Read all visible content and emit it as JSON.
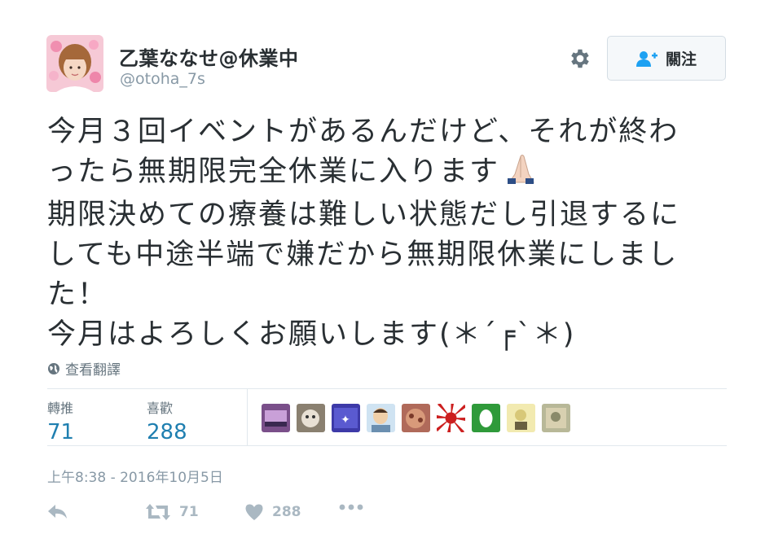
{
  "user": {
    "display_name": "乙葉ななせ@休業中",
    "handle": "@otoha_7s",
    "avatar_icon": "user-avatar-photo"
  },
  "header": {
    "settings_icon": "gear-icon",
    "follow_label": "關注",
    "follow_icon": "add-user-icon"
  },
  "tweet": {
    "lines": [
      "今月３回イベントがあるんだけど、それが終わ",
      "ったら無期限完全休業に入ります",
      "期限決めての療養は難しい状態だし引退するに",
      "しても中途半端で嫌だから無期限休業にしまし",
      "た！",
      "今月はよろしくお願いします(＊´╒`＊)"
    ],
    "emoji_icon": "folded-hands-icon"
  },
  "translate": {
    "label": "查看翻譯",
    "icon": "globe-icon"
  },
  "stats": {
    "retweets_label": "轉推",
    "retweets_count": "71",
    "likes_label": "喜歡",
    "likes_count": "288"
  },
  "likers": [
    {
      "icon": "liker-avatar-1",
      "color": "#7a4f8a"
    },
    {
      "icon": "liker-avatar-2",
      "color": "#8a8070"
    },
    {
      "icon": "liker-avatar-3",
      "color": "#3d3aa8"
    },
    {
      "icon": "liker-avatar-4",
      "color": "#6b8fb0"
    },
    {
      "icon": "liker-avatar-5",
      "color": "#b06a5a"
    },
    {
      "icon": "liker-avatar-6",
      "color": "#cc1f1f"
    },
    {
      "icon": "liker-avatar-7",
      "color": "#2f9a3a"
    },
    {
      "icon": "liker-avatar-8",
      "color": "#d8c878"
    },
    {
      "icon": "liker-avatar-9",
      "color": "#8a8a6a"
    }
  ],
  "timestamp": "上午8:38 - 2016年10月5日",
  "actions": {
    "reply_icon": "reply-icon",
    "retweet_icon": "retweet-icon",
    "retweet_count": "71",
    "like_icon": "heart-icon",
    "like_count": "288",
    "more_icon": "more-icon"
  },
  "colors": {
    "text": "#292f33",
    "muted": "#8899a6",
    "link_blue": "#1f7fb0",
    "follow_icon": "#1da1f2",
    "action_gray": "#aab8c2"
  }
}
